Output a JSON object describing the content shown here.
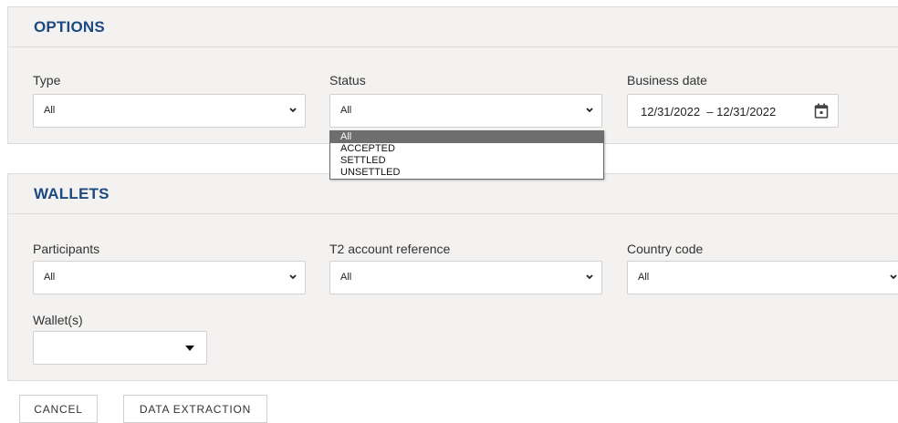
{
  "options": {
    "title": "OPTIONS",
    "type": {
      "label": "Type",
      "value": "All"
    },
    "status": {
      "label": "Status",
      "value": "All",
      "options": [
        "All",
        "ACCEPTED",
        "SETTLED",
        "UNSETTLED"
      ]
    },
    "business_date": {
      "label": "Business date",
      "value": "12/31/2022  – 12/31/2022",
      "icon": "calendar-icon"
    }
  },
  "wallets": {
    "title": "WALLETS",
    "participants": {
      "label": "Participants",
      "value": "All"
    },
    "t2_account": {
      "label": "T2 account reference",
      "value": "All"
    },
    "country_code": {
      "label": "Country code",
      "value": "All"
    },
    "wallets_field": {
      "label": "Wallet(s)",
      "value": ""
    }
  },
  "actions": {
    "cancel": "CANCEL",
    "data_extraction": "DATA EXTRACTION"
  },
  "colors": {
    "heading": "#1c4a80",
    "panel_bg": "#f3f2f1",
    "selected_option_bg": "#6e6e6e"
  }
}
